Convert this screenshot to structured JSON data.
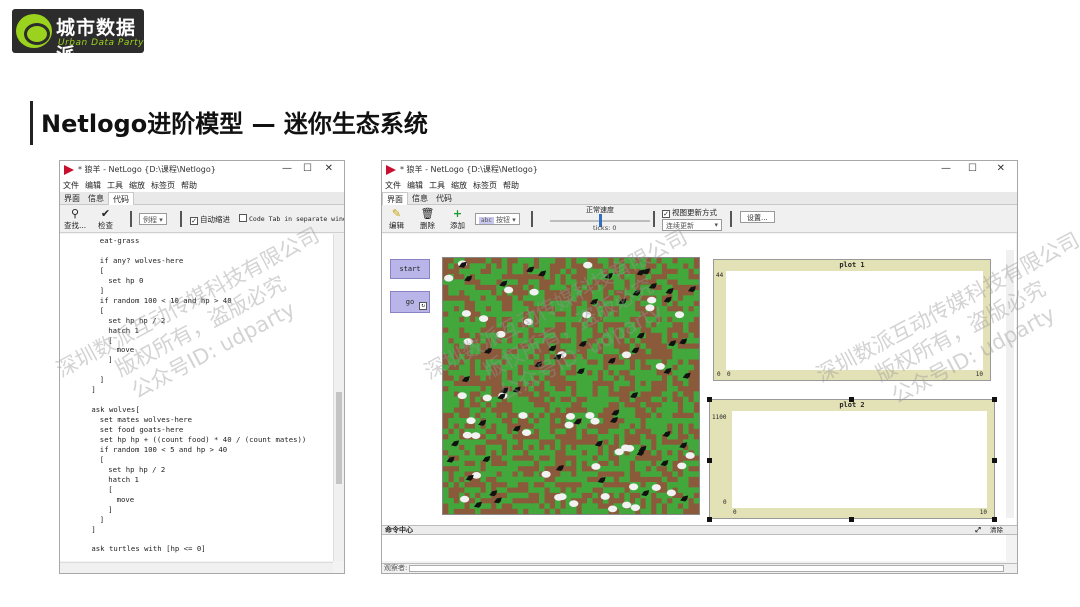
{
  "brand": {
    "name_cn": "城市数据派",
    "name_en": "Urban Data Party"
  },
  "slide_title": "Netlogo进阶模型 — 迷你生态系统",
  "code_window": {
    "title": "* 狼羊 - NetLogo {D:\\课程\\Netlogo}",
    "menu": [
      "文件",
      "编辑",
      "工具",
      "缩放",
      "标签页",
      "帮助"
    ],
    "tabs": [
      "界面",
      "信息",
      "代码"
    ],
    "active_tab": "代码",
    "toolbar": {
      "find": "查找...",
      "check": "检查",
      "procedures": "例程",
      "auto_indent": "自动缩进",
      "separate_window": "Code Tab in separate wind"
    },
    "code_lines": [
      {
        "text": "eat-grass",
        "indent": 2
      },
      {
        "text": "",
        "indent": 0
      },
      {
        "text": "if any? wolves-here",
        "indent": 2
      },
      {
        "text": "[",
        "indent": 2
      },
      {
        "text": "set hp 0",
        "indent": 3
      },
      {
        "text": "]",
        "indent": 2
      },
      {
        "text": "if random 100 < 10 and hp > 40",
        "indent": 2
      },
      {
        "text": "[",
        "indent": 2
      },
      {
        "text": "set hp hp / 2",
        "indent": 3
      },
      {
        "text": "hatch 1",
        "indent": 3
      },
      {
        "text": "[",
        "indent": 3
      },
      {
        "text": "move",
        "indent": 4
      },
      {
        "text": "]",
        "indent": 3
      },
      {
        "text": "",
        "indent": 0
      },
      {
        "text": "]",
        "indent": 2
      },
      {
        "text": "]",
        "indent": 1
      },
      {
        "text": "",
        "indent": 0
      },
      {
        "text": "ask wolves[",
        "indent": 1
      },
      {
        "text": "set mates wolves-here",
        "indent": 2
      },
      {
        "text": "set food goats-here",
        "indent": 2
      },
      {
        "text": "set hp hp + ((count food) * 40 / (count mates))",
        "indent": 2
      },
      {
        "text": "if random 100 < 5 and hp > 40",
        "indent": 2
      },
      {
        "text": "[",
        "indent": 2
      },
      {
        "text": "set hp hp / 2",
        "indent": 3
      },
      {
        "text": "hatch 1",
        "indent": 3
      },
      {
        "text": "[",
        "indent": 3
      },
      {
        "text": "move",
        "indent": 4
      },
      {
        "text": "]",
        "indent": 3
      },
      {
        "text": "]",
        "indent": 2
      },
      {
        "text": "]",
        "indent": 1
      },
      {
        "text": "",
        "indent": 0
      },
      {
        "text": "ask turtles with [hp <= 0]",
        "indent": 1
      }
    ]
  },
  "interface_window": {
    "title": "* 狼羊 - NetLogo {D:\\课程\\Netlogo}",
    "menu": [
      "文件",
      "编辑",
      "工具",
      "缩放",
      "标签页",
      "帮助"
    ],
    "tabs": [
      "界面",
      "信息",
      "代码"
    ],
    "active_tab": "界面",
    "toolbar": {
      "edit": "编辑",
      "delete": "删除",
      "add": "添加",
      "widget_select": "按钮",
      "speed_label": "正常速度",
      "ticks_label": "ticks: 0",
      "view_updates": "视图更新方式",
      "update_mode": "连续更新",
      "settings": "设置..."
    },
    "buttons": {
      "start": "start",
      "go": "go"
    },
    "plot1": {
      "title": "plot 1",
      "y_max": "44",
      "y_min": "0",
      "x_min": "0",
      "x_max": "10"
    },
    "plot2": {
      "title": "plot 2",
      "y_max": "1100",
      "y_min": "0",
      "x_min": "0",
      "x_max": "10"
    },
    "command_center": {
      "label": "命令中心",
      "clear": "清除",
      "observer": "观察者:"
    },
    "world": {
      "colors": {
        "soil": "#8a5a3b",
        "grass": "#43a83c",
        "goat": "#f2f2f2",
        "wolf": "#111111"
      },
      "goat_count": 48,
      "wolf_count": 55
    }
  },
  "watermark": {
    "line1": "深圳数派互动传媒科技有限公司",
    "line2": "版权所有，盗版必究",
    "line3": "公众号ID: udparty"
  }
}
